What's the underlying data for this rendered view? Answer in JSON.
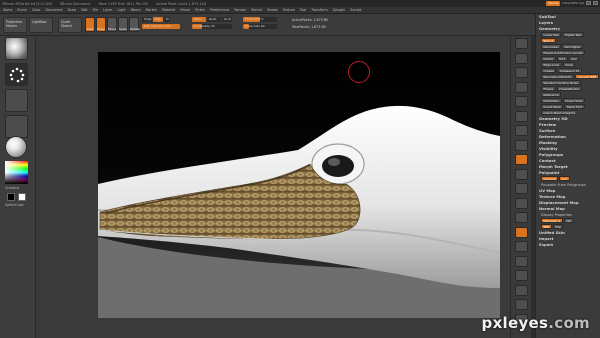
{
  "titlebar": {
    "segments": [
      "ZBrush 4R2b 64-bit [4:11:56]",
      "ZBrush Document",
      "Mem 1195 Free 1811 Pts 100",
      "Active Point Count 1,873,128"
    ],
    "badge": "Menus",
    "script": "DefaultZScript"
  },
  "menubar": {
    "items": [
      "Alpha",
      "Brush",
      "Color",
      "Document",
      "Draw",
      "Edit",
      "File",
      "Layer",
      "Light",
      "Macro",
      "Marker",
      "Material",
      "Movie",
      "Picker",
      "Preferences",
      "Render",
      "Stencil",
      "Stroke",
      "Texture",
      "Tool",
      "Transform",
      "Zplugin",
      "Zscript"
    ]
  },
  "shelf": {
    "projection_master": "Projection Master",
    "lightbox": "LightBox",
    "quick_sketch": "Quick Sketch",
    "edit": "Edit",
    "draw": "Draw",
    "move": "Move",
    "scale": "Scale",
    "rotate": "Rotate",
    "mrgb": "Mrgb",
    "rgb": "Rgb",
    "m": "M",
    "zadd": "Zadd",
    "zsub": "Zsub",
    "zcut": "Zcut",
    "rgb_intensity": "Rgb Intensity 100",
    "z_intensity": "Z Intensity 25",
    "focal_shift": "Focal Shift 0",
    "draw_size": "Draw Size 64",
    "active_points": "ActivePoints: 1.873 Mil",
    "total_points": "TotalPoints: 1.873 Mil"
  },
  "lefttray": {
    "gradient_label": "Gradient",
    "switch_color_label": "SwitchColor"
  },
  "palette": {
    "head1": "SubTool",
    "head2": "Layers",
    "rows": [
      {
        "label": "Geometry",
        "type": "head"
      },
      {
        "label": "Lower Res",
        "btns": [
          "Higher Res"
        ]
      },
      {
        "label": "SDiv 6",
        "btns": []
      },
      {
        "label": "Del Lower",
        "btns": [
          "Del Higher"
        ]
      },
      {
        "label": "Freeze SubDivision Levels",
        "btns": []
      },
      {
        "label": "Divide",
        "btns": [
          "Smt",
          "Suv"
        ]
      },
      {
        "label": "Edge Loop",
        "btns": [
          "Crisp"
        ]
      },
      {
        "label": "Crease",
        "btns": [
          "CreaseLvl 15"
        ]
      },
      {
        "label": "ReconstructSubdiv",
        "btns": [
          "Convert BPR"
        ]
      },
      {
        "label": "Sandbox Surface Noise",
        "btns": []
      },
      {
        "label": "Freeze",
        "btns": [
          "FreezeBorder"
        ]
      },
      {
        "label": "Reference",
        "btns": []
      },
      {
        "label": "DelHidden",
        "btns": [
          "Close Holes"
        ]
      },
      {
        "label": "Insert Mesh",
        "btns": [
          "Mesh Fold"
        ]
      },
      {
        "label": "Check Mesh Integrity",
        "btns": []
      }
    ],
    "sections": [
      "Geometry HD",
      "Preview",
      "Surface",
      "Deformation",
      "Masking",
      "Visibility",
      "Polygroups",
      "Contact",
      "Morph Target",
      "Polypaint"
    ],
    "polypaint_row": [
      "Colorize",
      "Grd"
    ],
    "polypaint_extra": "Polypaint From Polygroups",
    "sections2": [
      "UV Map",
      "Texture Map",
      "Displacement Map",
      "Normal Map"
    ],
    "display_properties": "Display Properties",
    "dp_row1": [
      "DSmooth 0",
      "Dbl"
    ],
    "dp_row2": [
      "BPR",
      "Flip"
    ],
    "sections3": [
      "Unified Skin",
      "Import",
      "Export"
    ]
  },
  "watermark": {
    "brand": "pxleyes",
    "tld": ".com"
  },
  "colors": {
    "accent": "#d9731f",
    "ui_bg": "#3a3a3a",
    "viewport_top": "#000000"
  },
  "icons": [
    "cursor-ring-icon",
    "gear-icon",
    "sphere-icon",
    "color-picker-icon"
  ]
}
